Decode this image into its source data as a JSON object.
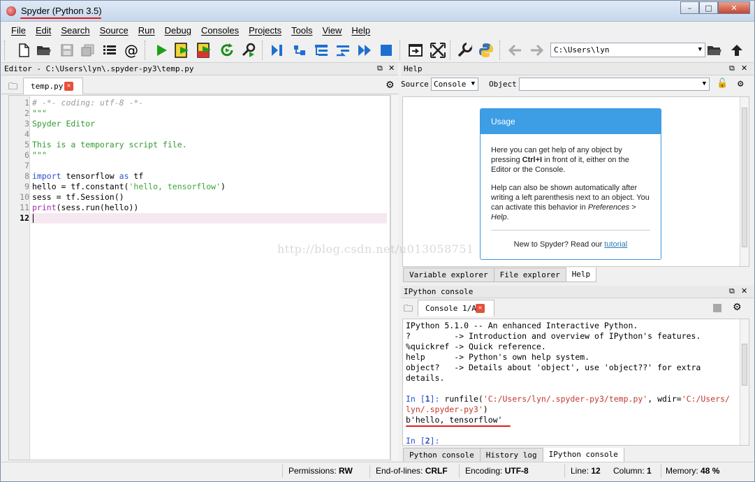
{
  "window": {
    "title": "Spyder (Python 3.5)",
    "min": "–",
    "max": "□",
    "close": "✕"
  },
  "menu": [
    "File",
    "Edit",
    "Search",
    "Source",
    "Run",
    "Debug",
    "Consoles",
    "Projects",
    "Tools",
    "View",
    "Help"
  ],
  "toolbar": {
    "path": "C:\\Users\\lyn",
    "icons": [
      "new-file-icon",
      "open-folder-icon",
      "save-icon",
      "save-all-icon",
      "outline-icon",
      "at-icon",
      "run-icon",
      "run-cell-icon",
      "run-cell-advance-icon",
      "rerun-icon",
      "config-run-icon",
      "debug-step-icon",
      "debug-step-into-icon",
      "debug-step-return-icon",
      "debug-continue-icon",
      "debug-stop-icon",
      "maximize-pane-icon",
      "fullscreen-icon",
      "preferences-icon",
      "python-path-icon",
      "back-arrow-icon",
      "forward-arrow-icon",
      "browse-folder-icon",
      "parent-dir-icon"
    ]
  },
  "editor": {
    "header": "Editor - C:\\Users\\lyn\\.spyder-py3\\temp.py",
    "tab": "temp.py",
    "lines": [
      {
        "n": "1",
        "t": "# -*- coding: utf-8 -*-"
      },
      {
        "n": "2",
        "t": "\"\"\""
      },
      {
        "n": "3",
        "t": "Spyder Editor"
      },
      {
        "n": "4",
        "t": ""
      },
      {
        "n": "5",
        "t": "This is a temporary script file."
      },
      {
        "n": "6",
        "t": "\"\"\""
      },
      {
        "n": "7",
        "t": ""
      },
      {
        "n": "8",
        "t": "import tensorflow as tf"
      },
      {
        "n": "9",
        "t": "hello = tf.constant('hello, tensorflow')"
      },
      {
        "n": "10",
        "t": "sess = tf.Session()"
      },
      {
        "n": "11",
        "t": "print(sess.run(hello))"
      },
      {
        "n": "12",
        "t": ""
      }
    ]
  },
  "help": {
    "header": "Help",
    "source_label": "Source",
    "source_value": "Console",
    "object_label": "Object",
    "usage_title": "Usage",
    "p1a": "Here you can get help of any object by pressing ",
    "p1b": "Ctrl+I",
    "p1c": " in front of it, either on the Editor or the Console.",
    "p2a": "Help can also be shown automatically after writing a left parenthesis next to an object. You can activate this behavior in ",
    "p2b": "Preferences > Help",
    "p2c": ".",
    "new_text": "New to Spyder? Read our ",
    "tutorial": "tutorial",
    "tabs": [
      "Variable explorer",
      "File explorer",
      "Help"
    ]
  },
  "console": {
    "header": "IPython console",
    "tab": "Console 1/A",
    "intro": [
      "IPython 5.1.0 -- An enhanced Interactive Python.",
      "?         -> Introduction and overview of IPython's features.",
      "%quickref -> Quick reference.",
      "help      -> Python's own help system.",
      "object?   -> Details about 'object', use 'object??' for extra",
      "details."
    ],
    "in1_prompt": "In [",
    "in1_num": "1",
    "in1_close": "]: ",
    "in1_cmd": "runfile(",
    "in1_arg1": "'C:/Users/lyn/.spyder-py3/temp.py'",
    "in1_mid": ", wdir=",
    "in1_arg2a": "'C:/Users/",
    "in1_arg2b": "lyn/.spyder-py3'",
    "in1_end": ")",
    "output": "b'hello, tensorflow'",
    "in2_prompt": "In [",
    "in2_num": "2",
    "in2_close": "]:",
    "tabs": [
      "Python console",
      "History log",
      "IPython console"
    ]
  },
  "status": {
    "perm_label": "Permissions:",
    "perm": "RW",
    "eol_label": "End-of-lines:",
    "eol": "CRLF",
    "enc_label": "Encoding:",
    "enc": "UTF-8",
    "line_label": "Line:",
    "line": "12",
    "col_label": "Column:",
    "col": "1",
    "mem_label": "Memory:",
    "mem": "48 %"
  },
  "watermark": "http://blog.csdn.net/u013058751"
}
